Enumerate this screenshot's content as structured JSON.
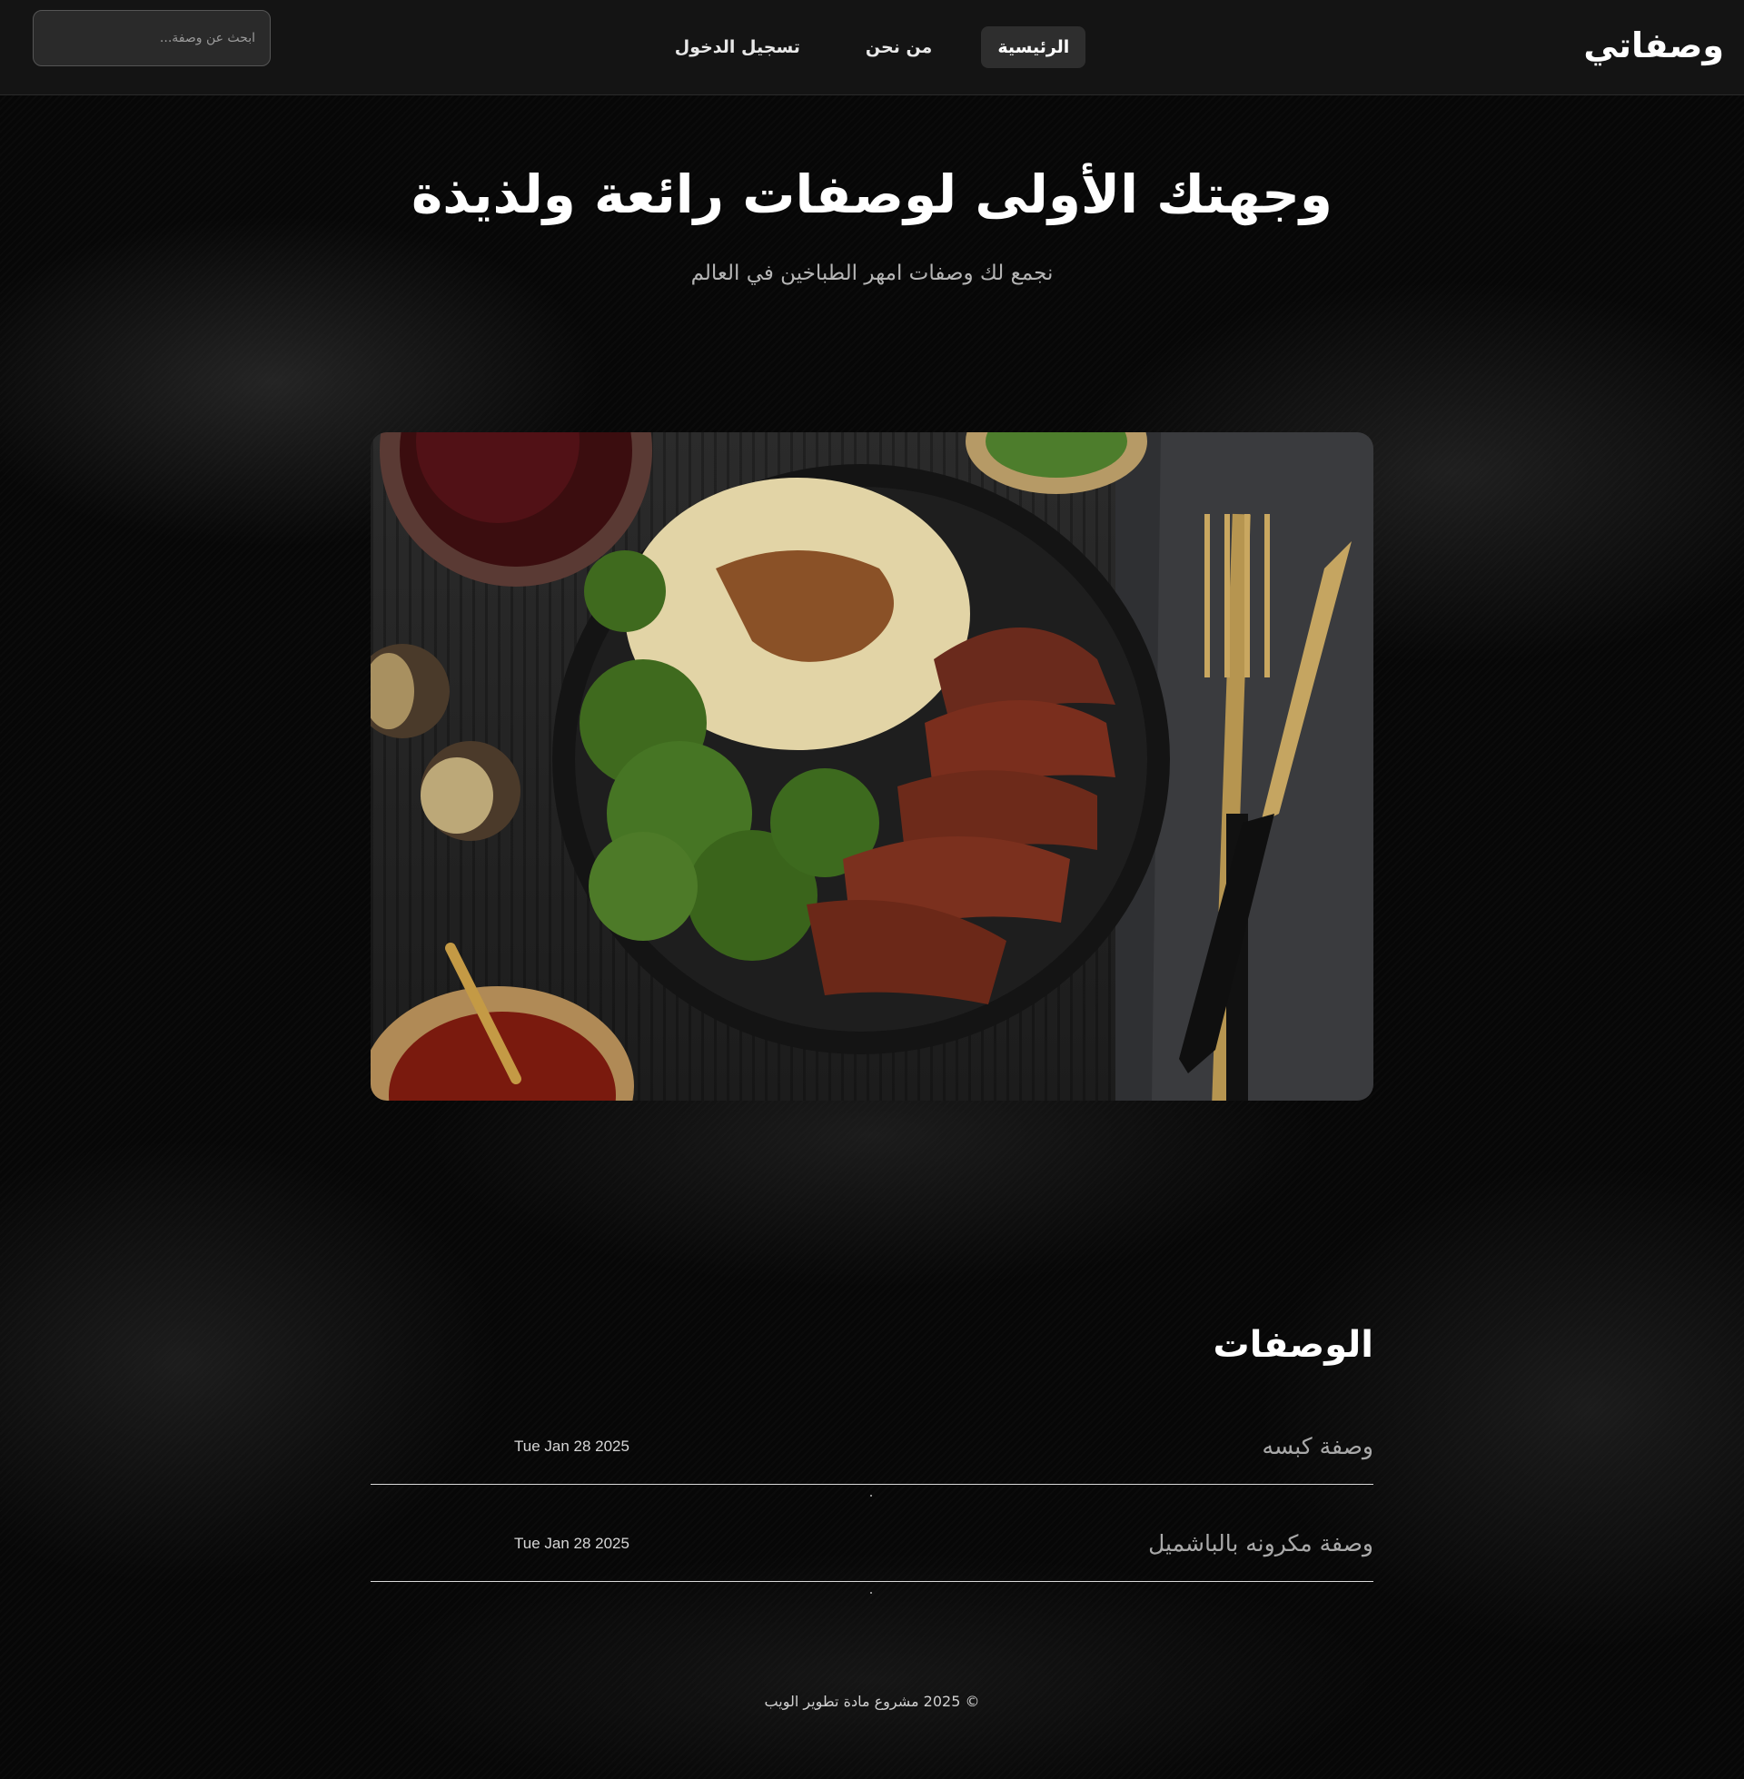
{
  "brand": "وصفاتي",
  "nav": {
    "items": [
      {
        "label": "الرئيسية"
      },
      {
        "label": "من نحن"
      },
      {
        "label": "تسجيل الدخول"
      }
    ]
  },
  "search": {
    "placeholder": "ابحث عن وصفة..."
  },
  "hero": {
    "title": "وجهتك الأولى لوصفات رائعة ولذيذة",
    "subtitle": "نجمع لك وصفات امهر الطباخين في العالم"
  },
  "recipes": {
    "title": "الوصفات",
    "items": [
      {
        "name": "وصفة كبسه",
        "date": "Tue Jan 28 2025"
      },
      {
        "name": "وصفة مكرونه بالباشميل",
        "date": "Tue Jan 28 2025"
      }
    ]
  },
  "footer": {
    "text": "© 2025 مشروع مادة تطوير الويب"
  }
}
